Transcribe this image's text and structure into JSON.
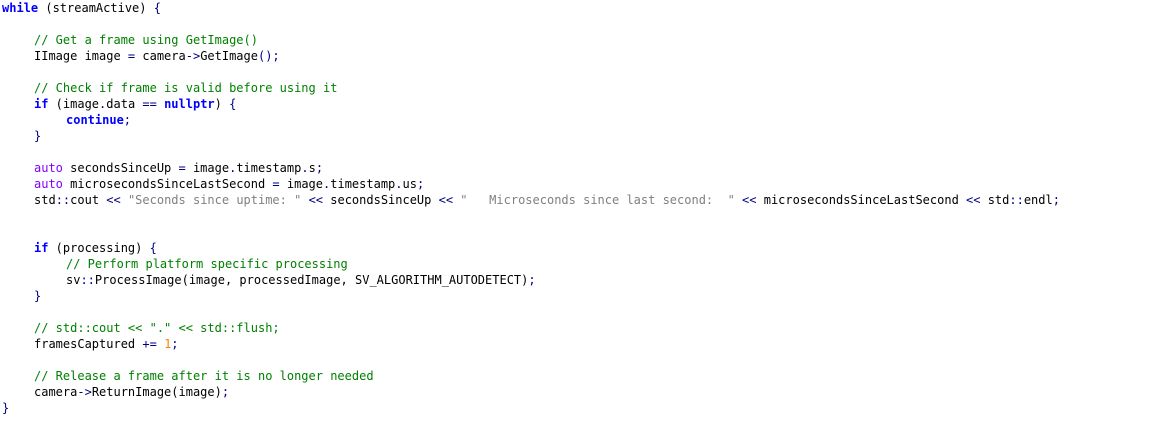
{
  "code": {
    "l1": {
      "kw": "while",
      "t1": " (streamActive) ",
      "br": "{"
    },
    "l2": {
      "cm": "// Get a frame using GetImage()"
    },
    "l3": {
      "t1": "IImage image ",
      "op1": "=",
      "t2": " camera",
      "op2": "->",
      "t3": "GetImage",
      "op3": "();"
    },
    "l4": {
      "cm": "// Check if frame is valid before using it"
    },
    "l5": {
      "kw": "if",
      "t1": " (image",
      "op1": ".",
      "t2": "data ",
      "op2": "==",
      "t3": " ",
      "kw2": "nullptr",
      "t4": ") ",
      "br": "{"
    },
    "l6": {
      "kw": "continue",
      "op": ";"
    },
    "l7": {
      "br": "}"
    },
    "l8": {
      "ty": "auto",
      "t1": " secondsSinceUp ",
      "op1": "=",
      "t2": " image",
      "op2": ".",
      "t3": "timestamp",
      "op3": ".",
      "t4": "s",
      "op4": ";"
    },
    "l9": {
      "ty": "auto",
      "t1": " microsecondsSinceLastSecond ",
      "op1": "=",
      "t2": " image",
      "op2": ".",
      "t3": "timestamp",
      "op3": ".",
      "t4": "us",
      "op4": ";"
    },
    "l10": {
      "t1": "std",
      "op1": "::",
      "t2": "cout ",
      "op2": "<<",
      "s1": " \"Seconds since uptime: \" ",
      "op3": "<<",
      "t3": " secondsSinceUp ",
      "op4": "<<",
      "s2": " \"   Microseconds since last second:  \" ",
      "op5": "<<",
      "t4": " microsecondsSinceLastSecond ",
      "op6": "<<",
      "t5": " std",
      "op7": "::",
      "t6": "endl",
      "op8": ";"
    },
    "l11": {
      "kw": "if",
      "t1": " (processing) ",
      "br": "{"
    },
    "l12": {
      "cm": "// Perform platform specific processing"
    },
    "l13": {
      "t1": "sv",
      "op1": "::",
      "t2": "ProcessImage(image, processedImage, SV_ALGORITHM_AUTODETECT)",
      "op2": ";"
    },
    "l14": {
      "br": "}"
    },
    "l15": {
      "cm": "// std::cout << \".\" << std::flush;"
    },
    "l16": {
      "t1": "framesCaptured ",
      "op1": "+=",
      "t2": " ",
      "num": "1",
      "op2": ";"
    },
    "l17": {
      "cm": "// Release a frame after it is no longer needed"
    },
    "l18": {
      "t1": "camera",
      "op1": "->",
      "t2": "ReturnImage(image)",
      "op2": ";"
    },
    "l19": {
      "br": "}"
    }
  },
  "colors": {
    "keyword": "#0000ff",
    "operator": "#000080",
    "comment": "#008000",
    "string": "#808080",
    "number": "#ff8000",
    "type": "#8000ff"
  }
}
